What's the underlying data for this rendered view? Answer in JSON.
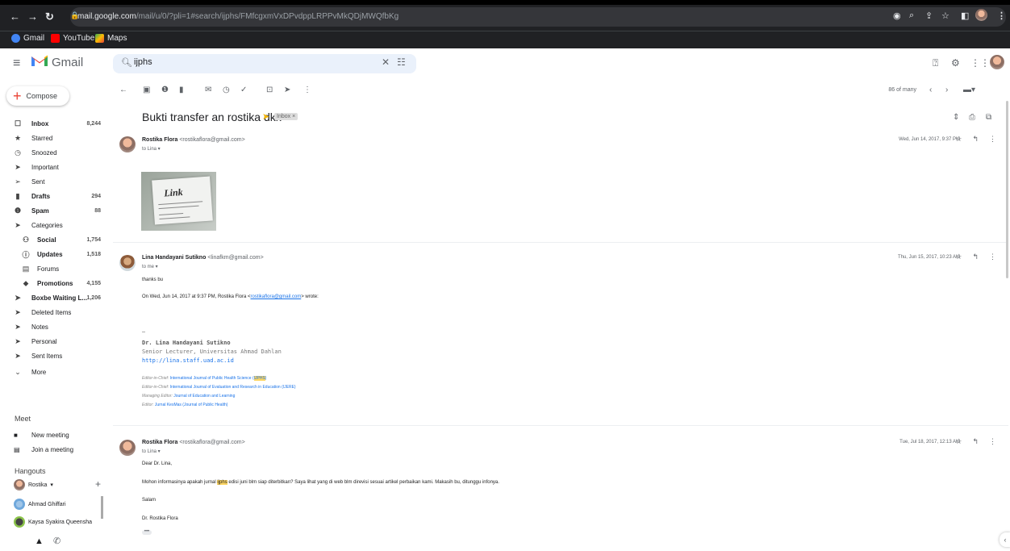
{
  "browser": {
    "url_host": "mail.google.com",
    "url_path": "/mail/u/0/?pli=1#search/ijphs/FMfcgxmVxDPvdppLRPPvMkQDjMWQfbKg",
    "bookmarks": [
      "Gmail",
      "YouTube",
      "Maps"
    ]
  },
  "header": {
    "app_name": "Gmail",
    "search_value": "ijphs"
  },
  "sidebar": {
    "compose_label": "Compose",
    "items": [
      {
        "label": "Inbox",
        "count": "8,244",
        "icon": "inbox-icon",
        "glyph": "☐",
        "bold": true
      },
      {
        "label": "Starred",
        "count": "",
        "icon": "star-icon",
        "glyph": "★",
        "bold": false
      },
      {
        "label": "Snoozed",
        "count": "",
        "icon": "clock-icon",
        "glyph": "◷",
        "bold": false
      },
      {
        "label": "Important",
        "count": "",
        "icon": "important-icon",
        "glyph": "➤",
        "bold": false
      },
      {
        "label": "Sent",
        "count": "",
        "icon": "send-icon",
        "glyph": "➢",
        "bold": false
      },
      {
        "label": "Drafts",
        "count": "294",
        "icon": "draft-icon",
        "glyph": "▮",
        "bold": true
      },
      {
        "label": "Spam",
        "count": "88",
        "icon": "spam-icon",
        "glyph": "❶",
        "bold": true
      },
      {
        "label": "Categories",
        "count": "",
        "icon": "label-icon",
        "glyph": "➤",
        "bold": false
      },
      {
        "label": "Social",
        "count": "1,754",
        "icon": "people-icon",
        "glyph": "⚇",
        "bold": true
      },
      {
        "label": "Updates",
        "count": "1,518",
        "icon": "info-icon",
        "glyph": "ⓘ",
        "bold": true
      },
      {
        "label": "Forums",
        "count": "",
        "icon": "forum-icon",
        "glyph": "▤",
        "bold": false
      },
      {
        "label": "Promotions",
        "count": "4,155",
        "icon": "tag-icon",
        "glyph": "⬥",
        "bold": true
      },
      {
        "label": "Boxbe Waiting L...",
        "count": "1,206",
        "icon": "label-icon",
        "glyph": "➤",
        "bold": true
      },
      {
        "label": "Deleted Items",
        "count": "",
        "icon": "label-icon",
        "glyph": "➤",
        "bold": false
      },
      {
        "label": "Notes",
        "count": "",
        "icon": "label-icon",
        "glyph": "➤",
        "bold": false
      },
      {
        "label": "Personal",
        "count": "",
        "icon": "label-icon",
        "glyph": "➤",
        "bold": false
      },
      {
        "label": "Sent Items",
        "count": "",
        "icon": "label-icon",
        "glyph": "➤",
        "bold": false
      },
      {
        "label": "More",
        "count": "",
        "icon": "chevron-down-icon",
        "glyph": "⌄",
        "bold": false
      }
    ],
    "meet_title": "Meet",
    "meet_items": [
      "New meeting",
      "Join a meeting"
    ],
    "hangouts_title": "Hangouts",
    "hangouts_user": "Rostika",
    "hangouts_contacts": [
      "Ahmad Ghiffari",
      "Kaysa Syakira Queensha"
    ]
  },
  "toolbar": {
    "paging": "86 of many"
  },
  "thread": {
    "subject": "Bukti transfer an rostika dkk",
    "label_chip": "Inbox ×",
    "messages": [
      {
        "sender": "Rostika Flora",
        "email": "<rostikaflora@gmail.com>",
        "to": "to Lina ▾",
        "date": "Wed, Jun 14, 2017, 9:37 PM",
        "image_text": "Link"
      },
      {
        "sender": "Lina Handayani Sutikno",
        "email": "<linafkm@gmail.com>",
        "to": "to me ▾",
        "date": "Thu, Jun 15, 2017, 10:23 AM",
        "body": "thanks bu",
        "quote_prefix": "On Wed, Jun 14, 2017 at 9:37 PM, Rostika Flora <",
        "quote_email": "rostikaflora@gmail.com",
        "quote_suffix": "> wrote:",
        "sig_dash": "--",
        "sig_name": "Dr. Lina Handayani Sutikno",
        "sig_title": "Senior Lecturer, Universitas Ahmad Dahlan",
        "sig_link": "http://lina.staff.uad.ac.id",
        "sig1_role": "Editor-in-Chief: ",
        "sig1_link": "International Journal of Public Health Science (",
        "sig1_hl": "IJPHS",
        "sig1_end": ")",
        "sig2_role": "Editor-in-Chief: ",
        "sig2_link": "International Journal of Evaluation and Research in Education (IJERE)",
        "sig3_role": "Managing Editor: ",
        "sig3_link": "Journal of Education and Learning",
        "sig4_role": "Editor: ",
        "sig4_link": "Jurnal KesMas (Journal of Public Health)"
      },
      {
        "sender": "Rostika Flora",
        "email": "<rostikaflora@gmail.com>",
        "to": "to Lina ▾",
        "date": "Tue, Jul 18, 2017, 12:13 AM",
        "greeting": "Dear Dr. Lina,",
        "body_pre": "Mohon informasinya apakah jurnal ",
        "body_hl": "ijphs",
        "body_post": " edisi juni blm siap diterbitkan?  Saya lihat yang di web blm direvisi sesuai artikel perbaikan kami.  Makasih bu,  ditunggu infonya.",
        "closing": "Salam",
        "signoff": "Dr. Rostika Flora"
      }
    ]
  }
}
